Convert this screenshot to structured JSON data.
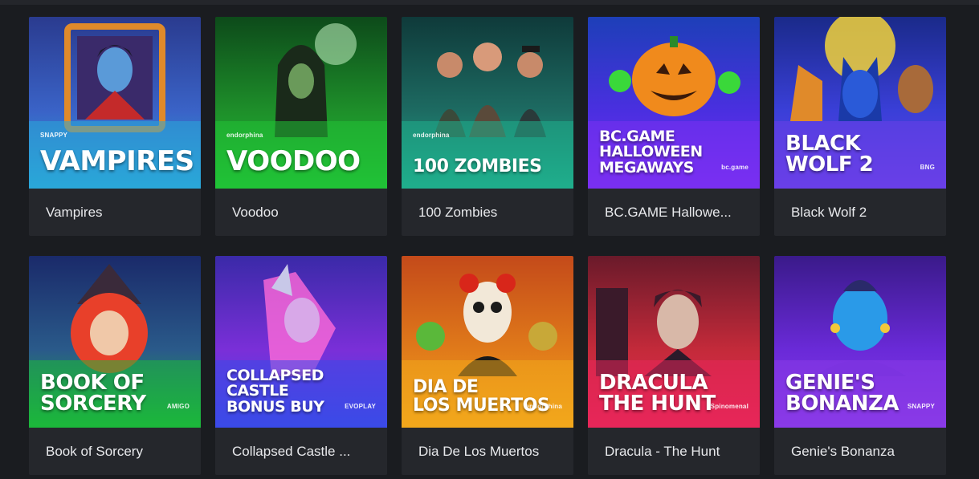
{
  "games": [
    {
      "name": "Vampires",
      "thumb_title": "VAMPIRES",
      "provider": "SNAPPY",
      "colors": {
        "top": "#2a3b8f",
        "mid": "#3a63c7",
        "bottom": "#2aa8d8",
        "accent": "#e0402a"
      },
      "icon": "vampire-art-icon"
    },
    {
      "name": "Voodoo",
      "thumb_title": "VOODOO",
      "provider": "endorphina",
      "colors": {
        "top": "#0d4a1a",
        "mid": "#1e8f2a",
        "bottom": "#21c236",
        "accent": "#7cff4a"
      },
      "icon": "voodoo-art-icon"
    },
    {
      "name": "100 Zombies",
      "thumb_title": "100 ZOMBIES",
      "provider": "endorphina",
      "colors": {
        "top": "#0f3a3a",
        "mid": "#1d6b62",
        "bottom": "#1fae8c",
        "accent": "#2ad9c6"
      },
      "icon": "zombies-art-icon"
    },
    {
      "name": "BC.GAME Hallowe...",
      "thumb_title": "BC.GAME HALLOWEEN\nMEGAWAYS",
      "provider": "bc.game",
      "colors": {
        "top": "#1d3fb8",
        "mid": "#4a2fe0",
        "bottom": "#7a2ff2",
        "accent": "#f08a1c"
      },
      "icon": "pumpkin-art-icon"
    },
    {
      "name": "Black Wolf 2",
      "thumb_title": "BLACK\nWOLF 2",
      "provider": "BNG",
      "colors": {
        "top": "#1a2a8a",
        "mid": "#3a3fd8",
        "bottom": "#6a3fe8",
        "accent": "#f2d23a"
      },
      "icon": "wolf-art-icon"
    },
    {
      "name": "Book of Sorcery",
      "thumb_title": "BOOK OF\nSORCERY",
      "provider": "AMIGO",
      "colors": {
        "top": "#1a2a6a",
        "mid": "#2a5a8a",
        "bottom": "#1cb83a",
        "accent": "#e8402a"
      },
      "icon": "sorceress-art-icon"
    },
    {
      "name": "Collapsed Castle ...",
      "thumb_title": "COLLAPSED CASTLE\nBONUS BUY",
      "provider": "EVOPLAY",
      "colors": {
        "top": "#3a2aa8",
        "mid": "#7a2fd8",
        "bottom": "#3a4ae8",
        "accent": "#ff6ad8"
      },
      "icon": "elf-art-icon"
    },
    {
      "name": "Dia De Los Muertos",
      "thumb_title": "DIA DE\nLOS MUERTOS",
      "provider": "endorphina",
      "colors": {
        "top": "#c44a1a",
        "mid": "#e07a1a",
        "bottom": "#f2a81c",
        "accent": "#d8261a"
      },
      "icon": "catrina-art-icon"
    },
    {
      "name": "Dracula - The Hunt",
      "thumb_title": "DRACULA\nTHE HUNT",
      "provider": "Spinomenal",
      "colors": {
        "top": "#6a1a2a",
        "mid": "#c42a3a",
        "bottom": "#e8265a",
        "accent": "#3a1a2a"
      },
      "icon": "dracula-art-icon"
    },
    {
      "name": "Genie's Bonanza",
      "thumb_title": "GENIE'S\nBONANZA",
      "provider": "SNAPPY",
      "colors": {
        "top": "#3a1a8a",
        "mid": "#6a2ad8",
        "bottom": "#8a3ae8",
        "accent": "#2a9ae8"
      },
      "icon": "genie-art-icon"
    }
  ]
}
